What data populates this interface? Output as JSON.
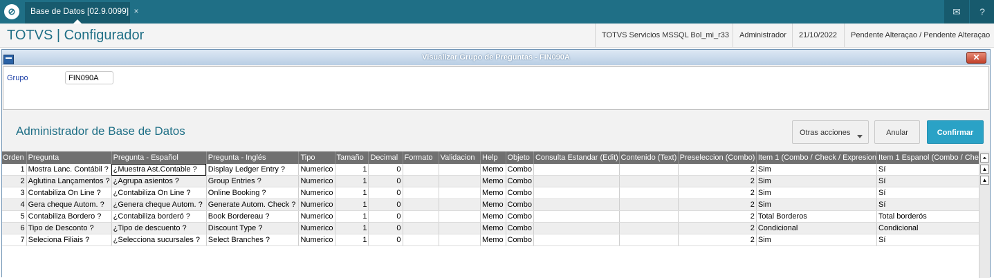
{
  "topbar": {
    "tab_label": "Base de Datos [02.9.0099]",
    "tab_close": "×",
    "mail_icon": "mail-icon",
    "help_icon": "help-icon"
  },
  "header": {
    "app_title": "TOTVS | Configurador",
    "environment": "TOTVS Servicios MSSQL Bol_mi_r33",
    "user": "Administrador",
    "date": "21/10/2022",
    "status": "Pendente Alteraçao / Pendente Alteraçao"
  },
  "dialog": {
    "title": "Visualizar Grupo de Preguntas - FIN090A",
    "close": "✕",
    "grupo_label": "Grupo",
    "grupo_value": "FIN090A"
  },
  "section": {
    "title": "Administrador de Base de Datos",
    "otras_acciones": "Otras acciones",
    "anular": "Anular",
    "confirmar": "Confirmar"
  },
  "table": {
    "columns": [
      "Orden",
      "Pregunta",
      "Pregunta - Español",
      "Pregunta - Inglés",
      "Tipo",
      "Tamaño",
      "Decimal",
      "Formato",
      "Validacion",
      "Help",
      "Objeto",
      "Consulta Estandar (Edit)",
      "Contenido (Text)",
      "Preseleccion (Combo)",
      "Item 1 (Combo / Check / Expresion",
      "Item 1 Espanol (Combo / Che"
    ],
    "rows": [
      [
        "1",
        "Mostra Lanc. Contábil ?",
        "¿Muestra Ast.Contable ?",
        "Display Ledger Entry ?",
        "Numerico",
        "1",
        "0",
        "",
        "",
        "Memo",
        "Combo",
        "",
        "",
        "2",
        "Sim",
        "Sí"
      ],
      [
        "2",
        "Aglutina Lançamentos ?",
        "¿Agrupa asientos ?",
        "Group Entries ?",
        "Numerico",
        "1",
        "0",
        "",
        "",
        "Memo",
        "Combo",
        "",
        "",
        "2",
        "Sim",
        "Sí"
      ],
      [
        "3",
        "Contabiliza On Line ?",
        "¿Contabiliza On Line ?",
        "Online Booking ?",
        "Numerico",
        "1",
        "0",
        "",
        "",
        "Memo",
        "Combo",
        "",
        "",
        "2",
        "Sim",
        "Sí"
      ],
      [
        "4",
        "Gera cheque Autom. ?",
        "¿Genera cheque Autom. ?",
        "Generate Autom. Check ?",
        "Numerico",
        "1",
        "0",
        "",
        "",
        "Memo",
        "Combo",
        "",
        "",
        "2",
        "Sim",
        "Sí"
      ],
      [
        "5",
        "Contabiliza Bordero ?",
        "¿Contabiliza borderó ?",
        "Book Bordereau ?",
        "Numerico",
        "1",
        "0",
        "",
        "",
        "Memo",
        "Combo",
        "",
        "",
        "2",
        "Total Borderos",
        "Total borderós"
      ],
      [
        "6",
        "Tipo de Desconto ?",
        "¿Tipo de descuento ?",
        "Discount Type ?",
        "Numerico",
        "1",
        "0",
        "",
        "",
        "Memo",
        "Combo",
        "",
        "",
        "2",
        "Condicional",
        "Condicional"
      ],
      [
        "7",
        "Seleciona Filiais ?",
        "¿Selecciona sucursales ?",
        "Select Branches ?",
        "Numerico",
        "1",
        "0",
        "",
        "",
        "Memo",
        "Combo",
        "",
        "",
        "2",
        "Sim",
        "Sí"
      ]
    ]
  }
}
